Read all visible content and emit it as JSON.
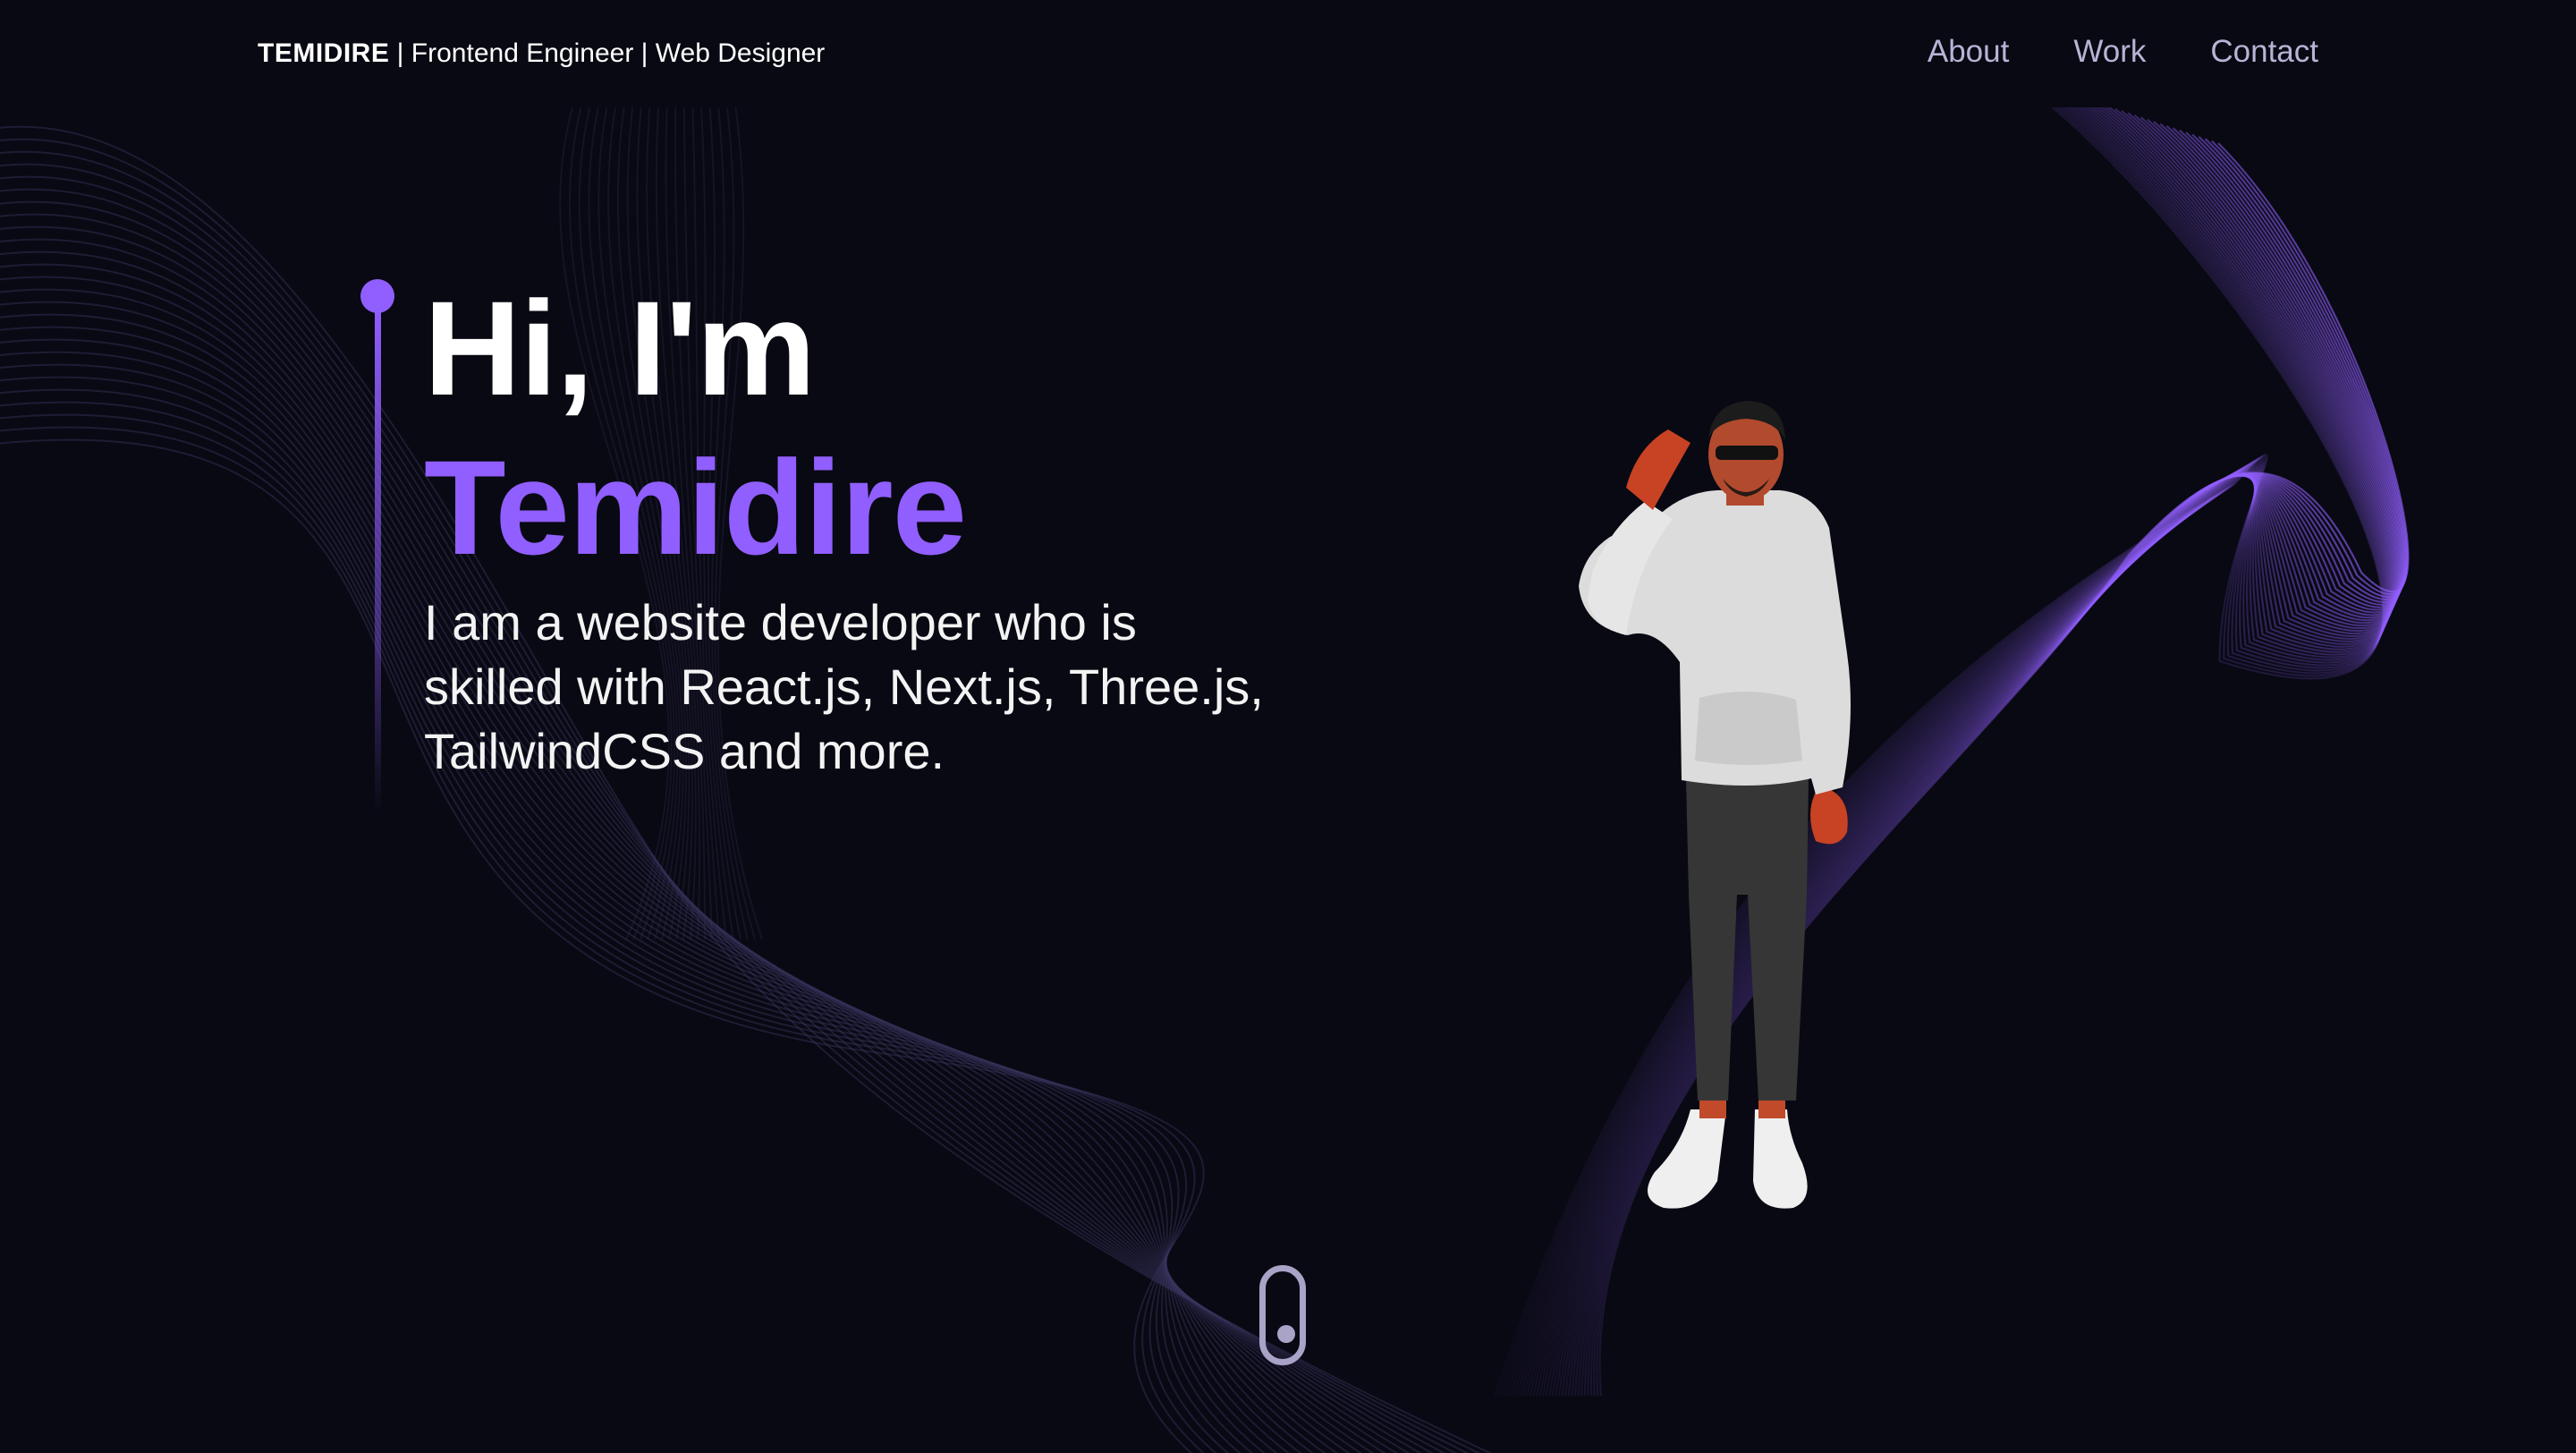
{
  "header": {
    "brand_name": "TEMIDIRE",
    "brand_tagline": " | Frontend Engineer | Web Designer",
    "nav": [
      {
        "label": "About"
      },
      {
        "label": "Work"
      },
      {
        "label": "Contact"
      }
    ]
  },
  "hero": {
    "greeting": "Hi, I'm",
    "name": "Temidire",
    "description": "I am a website developer who is skilled with React.js, Next.js, Three.js, TailwindCSS and more."
  },
  "colors": {
    "background": "#080912",
    "accent": "#915eff",
    "nav_text": "#b6b4d6",
    "scroll_indicator": "#a9a3c7"
  },
  "icons": {
    "scroll": "mouse-scroll-icon"
  }
}
